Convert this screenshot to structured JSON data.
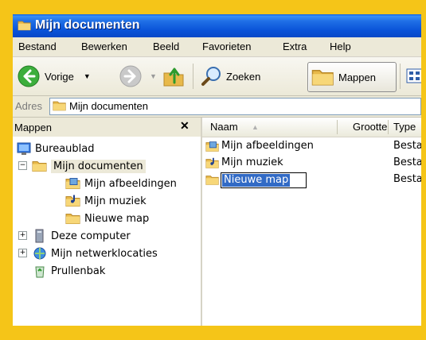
{
  "window": {
    "title": "Mijn documenten"
  },
  "menu": [
    "Bestand",
    "Bewerken",
    "Beeld",
    "Favorieten",
    "Extra",
    "Help"
  ],
  "toolbar": {
    "back_label": "Vorige",
    "search_label": "Zoeken",
    "folders_label": "Mappen"
  },
  "address": {
    "label": "Adres",
    "value": "Mijn documenten"
  },
  "folders_pane": {
    "title": "Mappen",
    "close_glyph": "✕",
    "tree": [
      {
        "label": "Bureaublad"
      },
      {
        "label": "Mijn documenten"
      },
      {
        "label": "Mijn afbeeldingen"
      },
      {
        "label": "Mijn muziek"
      },
      {
        "label": "Nieuwe map"
      },
      {
        "label": "Deze computer"
      },
      {
        "label": "Mijn netwerklocaties"
      },
      {
        "label": "Prullenbak"
      }
    ]
  },
  "list": {
    "columns": [
      "Naam",
      "Grootte",
      "Type"
    ],
    "rows": [
      {
        "name": "Mijn afbeeldingen",
        "type": "Besta"
      },
      {
        "name": "Mijn muziek",
        "type": "Besta"
      },
      {
        "name": "Nieuwe map",
        "type": "Besta"
      }
    ]
  },
  "colors": {
    "frame": "#f5c518",
    "titlebar": "#0a53d8",
    "selection": "#316ac5"
  }
}
